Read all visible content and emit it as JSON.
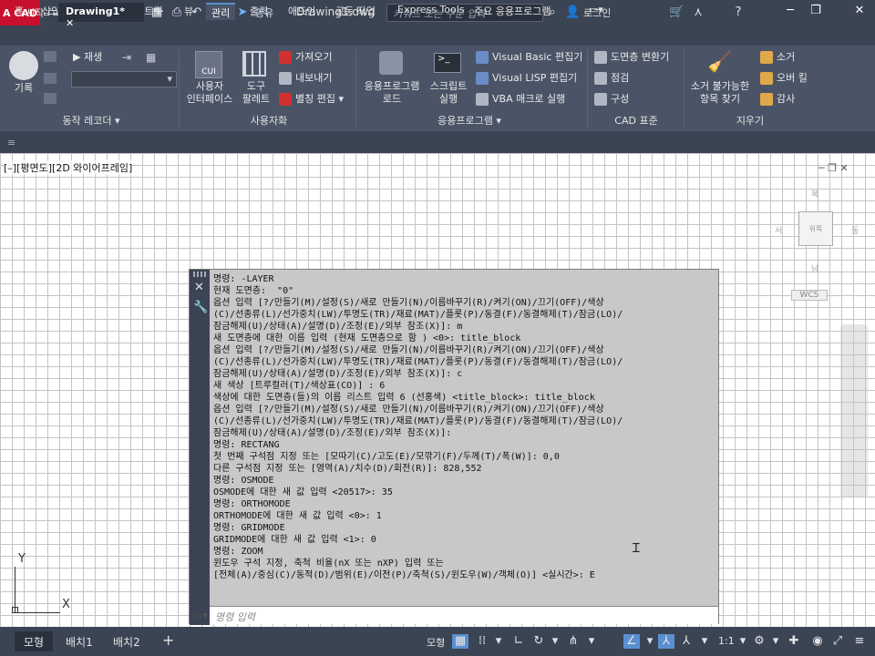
{
  "titlebar": {
    "logo": "A CAD",
    "share": "공유",
    "filename": "Drawing1.dwg",
    "search_placeholder": "키워드 또는 구문 입력",
    "login": "로그인"
  },
  "ribbon_tabs": [
    "홈",
    "삽입",
    "주석",
    "파라메트릭",
    "뷰",
    "관리",
    "출력",
    "애드인",
    "공동 작업",
    "Express Tools",
    "주요 응용프로그램"
  ],
  "active_tab": "관리",
  "ribbon": {
    "record": "기록",
    "play": "재생",
    "action_recorder": "동작 레코더 ▾",
    "cui": "사용자\n인터페이스",
    "tool_palette": "도구\n팔레트",
    "import": "가져오기",
    "export": "내보내기",
    "edit_aliases": "별칭 편집 ▾",
    "customization": "사용자화",
    "load_app": "응용프로그램\n로드",
    "run_script": "스크립트\n실행",
    "vb_editor": "Visual Basic 편집기",
    "lisp_editor": "Visual LISP 편집기",
    "vba_macro": "VBA 매크로 실행",
    "applications": "응용프로그램 ▾",
    "layer_translator": "도면층 변환기",
    "check": "점검",
    "configure": "구성",
    "cad_standards": "CAD 표준",
    "find_nonpurgeable": "소거 불가능한\n항목 찾기",
    "purge": "소거",
    "overkill": "오버 킬",
    "audit": "감사",
    "cleanup": "지우기"
  },
  "doc_tabs": {
    "start": "시작",
    "drawing": "Drawing1*",
    "close": "✕",
    "add": "+"
  },
  "viewport": {
    "label": "[–][평면도][2D 와이어프레임]",
    "cube_face": "위쪽",
    "wcs": "WCS",
    "y_axis": "Y",
    "x_axis": "X"
  },
  "command": {
    "lines": [
      "명령: -LAYER",
      "현재 도면층:  \"0\"",
      "옵션 입력 [?/만들기(M)/설정(S)/새로 만들기(N)/이름바꾸기(R)/켜기(ON)/끄기(OFF)/색상",
      "(C)/선종류(L)/선가중치(LW)/투명도(TR)/재료(MAT)/플롯(P)/동결(F)/동결해제(T)/잠금(LO)/",
      "잠금해제(U)/상태(A)/설명(D)/조정(E)/외부 참조(X)]: m",
      "새 도면층에 대한 이름 입력 (현재 도면층으로 함 ) <0>: title_block",
      "옵션 입력 [?/만들기(M)/설정(S)/새로 만들기(N)/이름바꾸기(R)/켜기(ON)/끄기(OFF)/색상",
      "(C)/선종류(L)/선가중치(LW)/투명도(TR)/재료(MAT)/플롯(P)/동결(F)/동결해제(T)/잠금(LO)/",
      "잠금해제(U)/상태(A)/설명(D)/조정(E)/외부 참조(X)]: c",
      "새 색상 [트루컬러(T)/색상표(CO)] : 6",
      "색상에 대한 도면층(들)의 이름 리스트 입력 6 (선홍색) <title_block>: title_block",
      "옵션 입력 [?/만들기(M)/설정(S)/새로 만들기(N)/이름바꾸기(R)/켜기(ON)/끄기(OFF)/색상",
      "(C)/선종류(L)/선가중치(LW)/투명도(TR)/재료(MAT)/플롯(P)/동결(F)/동결해제(T)/잠금(LO)/",
      "잠금해제(U)/상태(A)/설명(D)/조정(E)/외부 참조(X)]:",
      "명령: RECTANG",
      "첫 번째 구석점 지정 또는 [모따기(C)/고도(E)/모깎기(F)/두께(T)/폭(W)]: 0,0",
      "다른 구석점 지정 또는 [영역(A)/치수(D)/회전(R)]: 828,552",
      "명령: OSMODE",
      "OSMODE에 대한 새 값 입력 <20517>: 35",
      "명령: ORTHOMODE",
      "ORTHOMODE에 대한 새 값 입력 <0>: 1",
      "명령: GRIDMODE",
      "GRIDMODE에 대한 새 값 입력 <1>: 0",
      "명령: ZOOM",
      "윈도우 구석 지정, 축척 비율(nX 또는 nXP) 입력 또는",
      "[전체(A)/중심(C)/동적(D)/범위(E)/이전(P)/축척(S)/윈도우(W)/객체(O)] <실시간>: E"
    ],
    "input_placeholder": "명령 입력"
  },
  "status": {
    "model": "모형",
    "layout1": "배치1",
    "layout2": "배치2",
    "add": "+",
    "model_btn": "모형",
    "scale": "1:1"
  }
}
